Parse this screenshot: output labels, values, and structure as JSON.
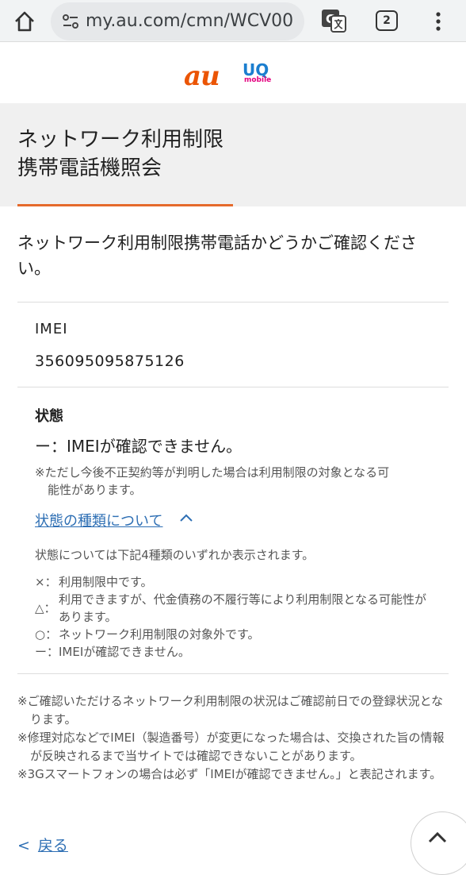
{
  "browser": {
    "url": "my.au.com/cmn/WCV00",
    "tab_count": "2"
  },
  "brand": {
    "au_logo": "au",
    "uq_logo": "UQ",
    "uq_sub": "mobile"
  },
  "page": {
    "title_line1": "ネットワーク利用制限",
    "title_line2": "携帯電話機照会",
    "intro": "ネットワーク利用制限携帯電話かどうかご確認ください。"
  },
  "imei": {
    "label": "IMEI",
    "value": "356095095875126"
  },
  "status": {
    "label": "状態",
    "value": "ー：IMEIが確認できません。",
    "note_line1": "※ただし今後不正契約等が判明した場合は利用制限の対象となる可",
    "note_line2": "能性があります。",
    "types_link": "状態の種類について",
    "types_intro": "状態については下記4種類のいずれか表示されます。",
    "types": [
      {
        "symbol": "×：",
        "text": "利用制限中です。"
      },
      {
        "symbol": "△：",
        "text": "利用できますが、代金債務の不履行等により利用制限となる可能性があります。"
      },
      {
        "symbol": "○：",
        "text": "ネットワーク利用制限の対象外です。"
      },
      {
        "symbol": "ー：",
        "text": "IMEIが確認できません。"
      }
    ]
  },
  "footnotes": [
    "※ご確認いただけるネットワーク利用制限の状況はご確認前日での登録状況となります。",
    "※修理対応などでIMEI（製造番号）が変更になった場合は、交換された旨の情報が反映されるまで当サイトでは確認できないことがあります。",
    "※3Gスマートフォンの場合は必ず「IMEIが確認できません。」と表記されます。"
  ],
  "nav": {
    "back_label": "戻る"
  }
}
